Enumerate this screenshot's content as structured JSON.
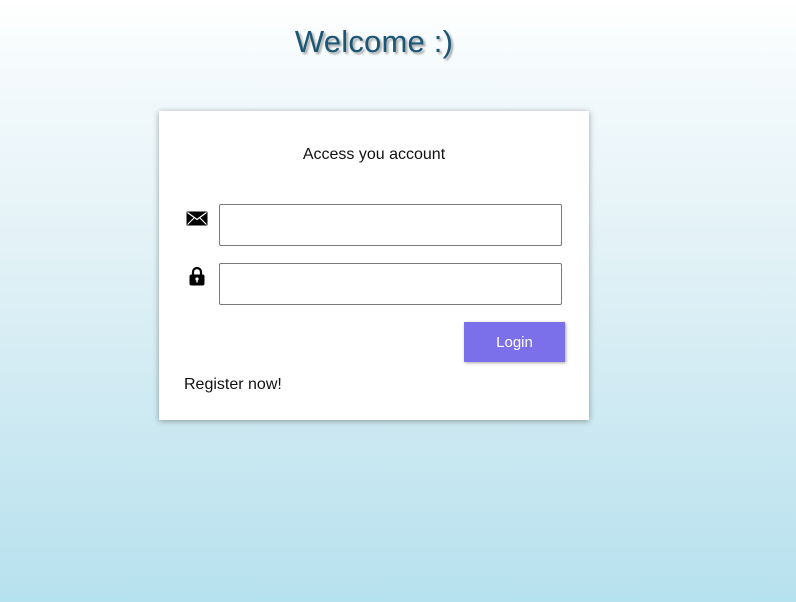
{
  "header": {
    "title": "Welcome :)"
  },
  "login_card": {
    "subtitle": "Access you account",
    "email_field": {
      "icon": "envelope-icon",
      "value": "",
      "placeholder": ""
    },
    "password_field": {
      "icon": "lock-icon",
      "value": "",
      "placeholder": ""
    },
    "login_label": "Login",
    "register_label": "Register now!"
  },
  "colors": {
    "title": "#1b5674",
    "button": "#7b6fea",
    "background_top": "#ffffff",
    "background_bottom": "#b6e1ee"
  }
}
